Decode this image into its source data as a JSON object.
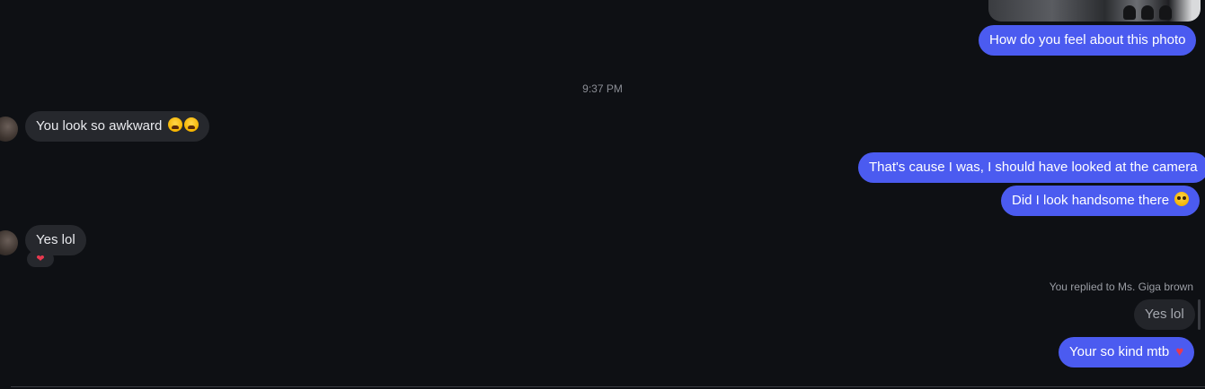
{
  "messages": {
    "m1": "How do you feel about this photo",
    "timestamp": "9:37 PM",
    "m2": "You look so awkward",
    "m3": "That's cause I was, I should have looked at the camera",
    "m4": "Did I look handsome there",
    "m5": "Yes lol",
    "reaction": "❤",
    "reply_label": "You replied to Ms. Giga brown",
    "quoted": "Yes lol",
    "m6": "Your so kind mtb"
  },
  "icons": {
    "m2_emoji": "loudly-crying-face-icon",
    "m4_emoji": "pleading-face-icon",
    "m6_emoji": "heart-icon"
  },
  "colors": {
    "outgoing_bubble": "#4b5bf0",
    "incoming_bubble": "#26282d",
    "background": "#0e1014"
  }
}
